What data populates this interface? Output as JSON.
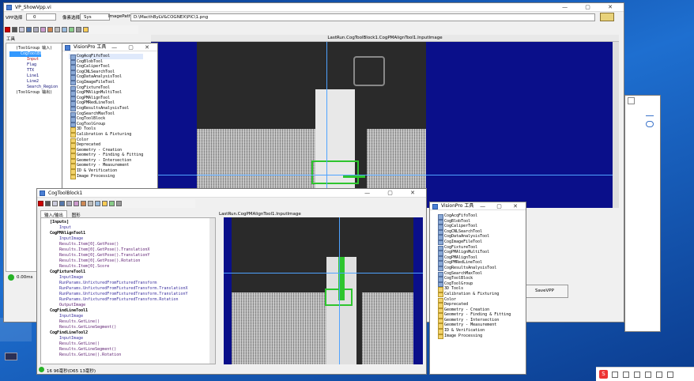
{
  "main": {
    "title": "VP_ShowVpp.vi",
    "vpp_label": "VPP选择",
    "vpp_value": "0",
    "image_source_label": "像素选择",
    "image_source_value": "Sys",
    "image_path_label": "ImagePath",
    "image_path_value": "D:\\MacthByLV&COGNEX\\PIC\\1.png",
    "tools_label": "工具",
    "display_caption": "LastRun.CogToolBlock1.CogPMAlignTool1.InputImage",
    "status_time": "0.00ms",
    "save_button": "SaveVPP"
  },
  "left_tree": [
    "(ToolGroup 输入)",
    "CogToolBlock1",
    "Input",
    "Flag",
    "TTX",
    "Line1",
    "Line2",
    "Search_Region",
    "(ToolGroup 输出)"
  ],
  "toolbox1": {
    "title": "VisionPro 工具",
    "items": [
      "CogAcqFifoTool",
      "CogBlobTool",
      "CogCaliperTool",
      "CogCNLSearchTool",
      "CogDataAnalysisTool",
      "CogImageFileTool",
      "CogFixtureTool",
      "CogPMAlignMultiTool",
      "CogPMAlignTool",
      "CogPMRedLineTool",
      "CogResultsAnalysisTool",
      "CogSearchMaxTool",
      "CogToolBlock",
      "CogToolGroup"
    ],
    "folders": [
      "3D Tools",
      "Calibration & Fixturing",
      "Color",
      "Deprecated",
      "Geometry - Creation",
      "Geometry - Finding & Fitting",
      "Geometry - Intersection",
      "Geometry - Measurement",
      "ID & Verification",
      "Image Processing"
    ]
  },
  "toolbox2": {
    "title": "VisionPro 工具",
    "items": [
      "CogAcqFifoTool",
      "CogBlobTool",
      "CogCaliperTool",
      "CogCNLSearchTool",
      "CogDataAnalysisTool",
      "CogImageFileTool",
      "CogFixtureTool",
      "CogPMAlignMultiTool",
      "CogPMAlignTool",
      "CogPMRedLineTool",
      "CogResultsAnalysisTool",
      "CogSearchMaxTool",
      "CogToolBlock",
      "CogToolGroup"
    ],
    "folders": [
      "3D Tools",
      "Calibration & Fixturing",
      "Color",
      "Deprecated",
      "Geometry - Creation",
      "Geometry - Finding & Fitting",
      "Geometry - Intersection",
      "Geometry - Measurement",
      "ID & Verification",
      "Image Processing"
    ]
  },
  "toolblock": {
    "title": "CogToolBlock1",
    "tabs": [
      "输入/输出",
      "图形"
    ],
    "display_caption": "LastRun.CogPMAlignTool1.InputImage",
    "status": "16 96毫秒(D65 13毫秒)",
    "tree": [
      {
        "t": "[Inputs]",
        "k": "h"
      },
      {
        "t": "Input",
        "k": "i"
      },
      {
        "t": "CogPMAlignTool1",
        "k": "h"
      },
      {
        "t": "InputImage",
        "k": "i"
      },
      {
        "t": "Results.Item[0].GetPose()",
        "k": "o"
      },
      {
        "t": "Results.Item[0].GetPose().TranslationX",
        "k": "o"
      },
      {
        "t": "Results.Item[0].GetPose().TranslationY",
        "k": "o"
      },
      {
        "t": "Results.Item[0].GetPose().Rotation",
        "k": "o"
      },
      {
        "t": "Results.Item[0].Score",
        "k": "o"
      },
      {
        "t": "CogFixtureTool1",
        "k": "h"
      },
      {
        "t": "InputImage",
        "k": "i"
      },
      {
        "t": "RunParams.UnfixturedFromFixturedTransform",
        "k": "i"
      },
      {
        "t": "RunParams.UnfixturedFromFixturedTransform.TranslationX",
        "k": "i"
      },
      {
        "t": "RunParams.UnfixturedFromFixturedTransform.TranslationY",
        "k": "i"
      },
      {
        "t": "RunParams.UnfixturedFromFixturedTransform.Rotation",
        "k": "i"
      },
      {
        "t": "OutputImage",
        "k": "o"
      },
      {
        "t": "CogFindLineTool1",
        "k": "h"
      },
      {
        "t": "InputImage",
        "k": "i"
      },
      {
        "t": "Results.GetLine()",
        "k": "o"
      },
      {
        "t": "Results.GetLineSegment()",
        "k": "o"
      },
      {
        "t": "CogFindLineTool2",
        "k": "h"
      },
      {
        "t": "InputImage",
        "k": "i"
      },
      {
        "t": "Results.GetLine()",
        "k": "o"
      },
      {
        "t": "Results.GetLineSegment()",
        "k": "o"
      },
      {
        "t": "Results.GetLine().Rotation",
        "k": "o"
      }
    ]
  },
  "explorer": {
    "search_icon": "search-icon"
  },
  "taskbar": {
    "ime_label": "S"
  }
}
